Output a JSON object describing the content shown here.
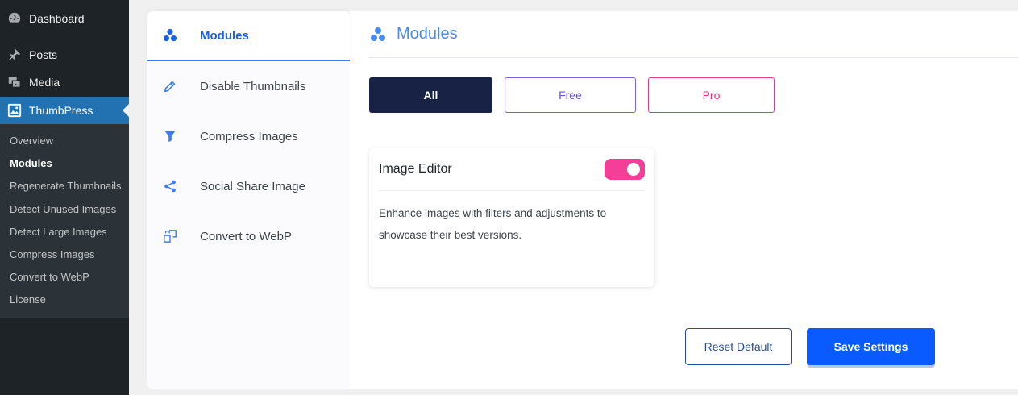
{
  "wp_menu": {
    "items": [
      {
        "label": "Dashboard",
        "icon": "dashboard-icon"
      },
      {
        "label": "Posts",
        "icon": "pin-icon"
      },
      {
        "label": "Media",
        "icon": "media-icon"
      },
      {
        "label": "ThumbPress",
        "icon": "thumbpress-icon"
      }
    ],
    "submenu": [
      "Overview",
      "Modules",
      "Regenerate Thumbnails",
      "Detect Unused Images",
      "Detect Large Images",
      "Compress Images",
      "Convert to WebP",
      "License"
    ]
  },
  "tabs": [
    {
      "label": "Modules",
      "icon": "modules-icon"
    },
    {
      "label": "Disable Thumbnails",
      "icon": "pencil-icon"
    },
    {
      "label": "Compress Images",
      "icon": "funnel-icon"
    },
    {
      "label": "Social Share Image",
      "icon": "share-icon"
    },
    {
      "label": "Convert to WebP",
      "icon": "convert-icon"
    }
  ],
  "content": {
    "title": "Modules",
    "filters": {
      "all": "All",
      "free": "Free",
      "pro": "Pro"
    },
    "module": {
      "title": "Image Editor",
      "description": "Enhance images with filters and adjustments to showcase their best versions.",
      "enabled": true
    },
    "actions": {
      "reset": "Reset Default",
      "save": "Save Settings"
    }
  },
  "colors": {
    "sidebar_bg": "#1d2327",
    "wp_accent": "#2271b1",
    "primary_blue": "#0a5bff",
    "dark_navy": "#172244",
    "free_purple": "#6b53d6",
    "pro_pink": "#e0317f",
    "toggle_on": "#f43f98"
  }
}
